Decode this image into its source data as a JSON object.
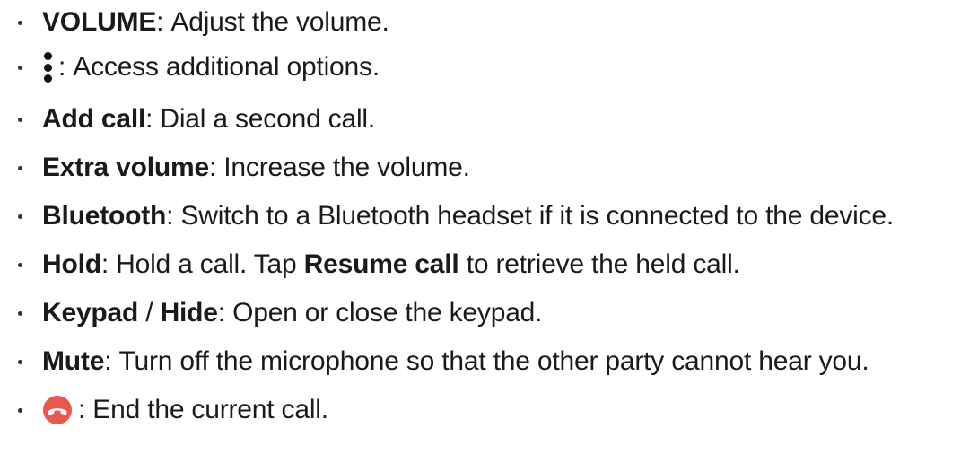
{
  "items": [
    {
      "term": "VOLUME",
      "sep": ": ",
      "desc": "Adjust the volume."
    },
    {
      "icon": "more-options-icon",
      "sep": ": ",
      "desc": "Access additional options."
    },
    {
      "term": "Add call",
      "sep": ": ",
      "desc": "Dial a second call."
    },
    {
      "term": "Extra volume",
      "sep": ": ",
      "desc": "Increase the volume."
    },
    {
      "term": "Bluetooth",
      "sep": ": ",
      "desc": "Switch to a Bluetooth headset if it is connected to the device."
    },
    {
      "term": "Hold",
      "sep": ": ",
      "desc": "Hold a call. Tap ",
      "term2": "Resume call",
      "desc2": " to retrieve the held call."
    },
    {
      "term": "Keypad",
      "slash": " / ",
      "term_b": "Hide",
      "sep": ": ",
      "desc": "Open or close the keypad."
    },
    {
      "term": "Mute",
      "sep": ": ",
      "desc": "Turn off the microphone so that the other party cannot hear you."
    },
    {
      "icon": "end-call-icon",
      "sep": ": ",
      "desc": "End the current call."
    }
  ],
  "colors": {
    "end_call_red": "#e8584f",
    "text": "#1a1a1a"
  }
}
